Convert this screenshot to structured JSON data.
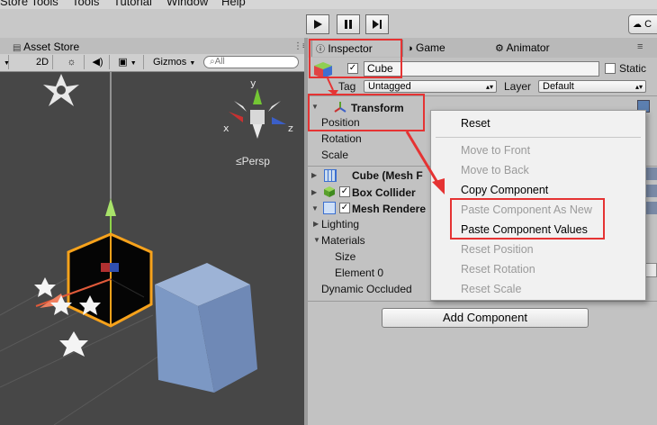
{
  "menubar": {
    "items": [
      "Store Tools",
      "Tools",
      "Tutorial",
      "Window",
      "Help"
    ]
  },
  "toolbar": {
    "play_icon": "play-icon",
    "pause_icon": "pause-icon",
    "step_icon": "step-icon",
    "cloud_label": "C"
  },
  "scene": {
    "tab_label": "Asset Store",
    "mode_2d": "2D",
    "gizmos_label": "Gizmos",
    "search_placeholder": "All",
    "persp_label": "Persp",
    "gizmo_axes": {
      "x": "x",
      "y": "y",
      "z": "z"
    }
  },
  "inspector_tabs": {
    "inspector": "Inspector",
    "game": "Game",
    "animator": "Animator"
  },
  "object": {
    "name": "Cube",
    "active": true,
    "static_label": "Static",
    "tag_label": "Tag",
    "tag_value": "Untagged",
    "layer_label": "Layer",
    "layer_value": "Default"
  },
  "components": {
    "transform": {
      "title": "Transform",
      "fields": [
        "Position",
        "Rotation",
        "Scale"
      ]
    },
    "mesh_filter": {
      "title": "Cube (Mesh F"
    },
    "box_collider": {
      "title": "Box Collider"
    },
    "mesh_renderer": {
      "title": "Mesh Rendere",
      "fields": [
        "Lighting",
        "Materials",
        "Size",
        "Element 0",
        "Dynamic Occluded"
      ]
    }
  },
  "add_component_label": "Add Component",
  "context_menu": {
    "items": [
      {
        "label": "Reset",
        "enabled": true
      },
      {
        "label": "Move to Front",
        "enabled": false
      },
      {
        "label": "Move to Back",
        "enabled": false
      },
      {
        "label": "Copy Component",
        "enabled": true
      },
      {
        "label": "Paste Component As New",
        "enabled": false
      },
      {
        "label": "Paste Component Values",
        "enabled": true
      },
      {
        "label": "Reset Position",
        "enabled": false
      },
      {
        "label": "Reset Rotation",
        "enabled": false
      },
      {
        "label": "Reset Scale",
        "enabled": false
      }
    ]
  },
  "colors": {
    "annotation": "#e53333",
    "selection_outline": "#f7a21b",
    "scene_bg": "#474747",
    "inspector_bg": "#c2c2c2"
  }
}
